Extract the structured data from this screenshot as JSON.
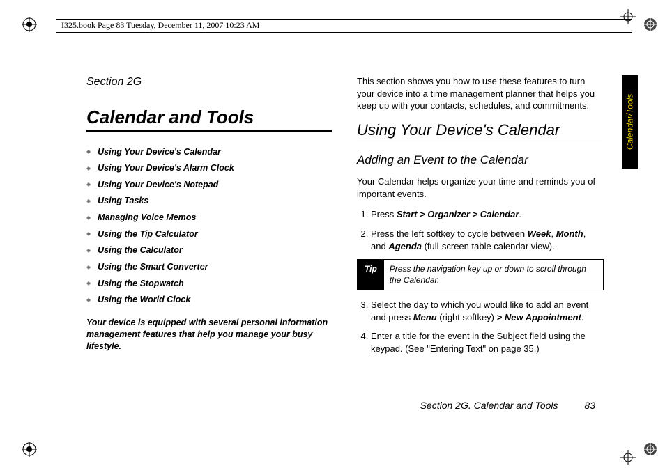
{
  "header": {
    "crop_text": "I325.book  Page 83  Tuesday, December 11, 2007  10:23 AM"
  },
  "side_tab": "Calendar/Tools",
  "left_col": {
    "section_label": "Section 2G",
    "title": "Calendar and Tools",
    "toc": [
      "Using Your Device's Calendar",
      "Using Your Device's Alarm Clock",
      "Using Your Device's Notepad",
      "Using Tasks",
      "Managing Voice Memos",
      "Using the Tip Calculator",
      "Using the Calculator",
      "Using the Smart Converter",
      "Using the Stopwatch",
      "Using the World Clock"
    ],
    "intro": "Your device is equipped with several personal information management features that help you manage your busy lifestyle."
  },
  "right_col": {
    "intro": "This section shows you how to use these features to turn your device into a time management planner that helps you keep up with your contacts, schedules, and commitments.",
    "h2": "Using Your Device's Calendar",
    "h3": "Adding an Event to the Calendar",
    "body1": "Your Calendar helps organize your time and reminds you of important events.",
    "step1_pre": "Press ",
    "step1_bold": "Start > Organizer > Calendar",
    "step1_post": ".",
    "step2_pre": "Press the left softkey to cycle between ",
    "step2_b1": "Week",
    "step2_mid1": ", ",
    "step2_b2": "Month",
    "step2_mid2": ", and ",
    "step2_b3": "Agenda",
    "step2_post": " (full-screen table calendar view).",
    "tip_label": "Tip",
    "tip_text": "Press the navigation key up or down to scroll through the Calendar.",
    "step3_pre": "Select the day to which you would like to add an event and press ",
    "step3_b1": "Menu",
    "step3_mid": " (right softkey) ",
    "step3_b2": "> New Appointment",
    "step3_post": ".",
    "step4": "Enter a title for the event in the Subject field using the keypad. (See \"Entering Text\" on page 35.)"
  },
  "footer": {
    "text": "Section 2G. Calendar and Tools",
    "page": "83"
  }
}
